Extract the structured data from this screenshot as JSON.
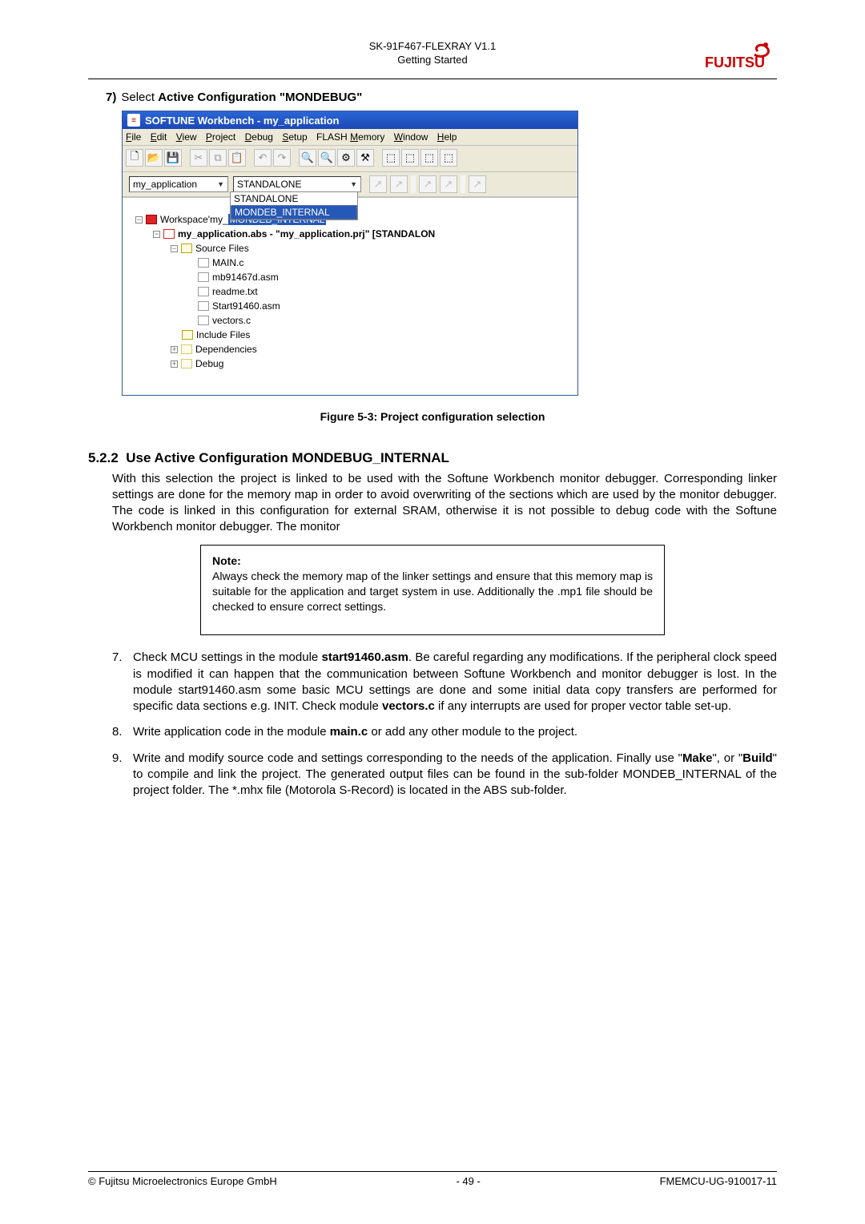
{
  "header": {
    "doc_title": "SK-91F467-FLEXRAY V1.1",
    "section": "Getting Started",
    "logo_text": "FUJITSU"
  },
  "step7": {
    "num": "7)",
    "pre": "Select ",
    "bold": "Active Configuration \"MONDEBUG\""
  },
  "ss": {
    "title_icon": "≡",
    "title": "SOFTUNE Workbench - my_application",
    "menus": [
      "File",
      "Edit",
      "View",
      "Project",
      "Debug",
      "Setup",
      "FLASH Memory",
      "Window",
      "Help"
    ],
    "proj_select": "my_application",
    "config_select": "STANDALONE",
    "options": [
      "STANDALONE",
      "MONDEB_INTERNAL"
    ],
    "tree": {
      "ws": "Workspace'my_",
      "ws_tail": "MONDEB_INTERNAL",
      "app": "my_application.abs - \"my_application.prj\" [STANDALON",
      "srcfolder": "Source Files",
      "files": [
        "MAIN.c",
        "mb91467d.asm",
        "readme.txt",
        "Start91460.asm",
        "vectors.c"
      ],
      "inc": "Include Files",
      "dep": "Dependencies",
      "dbg": "Debug"
    }
  },
  "figcap": "Figure 5-3: Project configuration selection",
  "sec": {
    "num": "5.2.2",
    "title": "Use Active Configuration MONDEBUG_INTERNAL"
  },
  "para1": "With this selection the project is linked to be used with the Softune Workbench monitor debugger. Corresponding linker settings are done for the memory map in order to avoid overwriting of the sections which are used by the monitor debugger. The code is linked in this configuration for external SRAM, otherwise it is not possible to debug code with the Softune Workbench monitor debugger. The monitor",
  "note": {
    "title": "Note:",
    "body": "Always check the memory map of the linker settings and ensure that this memory map is suitable for the application and target system in use. Additionally the .mp1 file should be checked to ensure correct settings."
  },
  "li7": {
    "num": "7.",
    "a": "Check MCU settings in the module ",
    "b1": "start91460.asm",
    "b": ". Be careful regarding any modifications. If the peripheral clock speed is modified it can happen that the communication between Softune Workbench and monitor debugger is lost. In the module start91460.asm some basic MCU settings are done and some initial data copy transfers are performed for specific data sections e.g. INIT. Check module ",
    "b2": "vectors.c",
    "c": " if any interrupts are used for proper vector table set-up."
  },
  "li8": {
    "num": "8.",
    "a": "Write application code in the module ",
    "b1": "main.c",
    "b": " or add any other module to the project."
  },
  "li9": {
    "num": "9.",
    "a": "Write and modify source code and settings corresponding to the needs of the application. Finally use \"",
    "b1": "Make",
    "mid": "\", or \"",
    "b2": "Build",
    "b": "\" to compile and link the project. The generated output files can be found in the sub-folder MONDEB_INTERNAL of the project folder. The *.mhx file (Motorola S-Record) is located in the ABS sub-folder."
  },
  "footer": {
    "left": "© Fujitsu Microelectronics Europe GmbH",
    "center": "- 49 -",
    "right": "FMEMCU-UG-910017-11"
  }
}
